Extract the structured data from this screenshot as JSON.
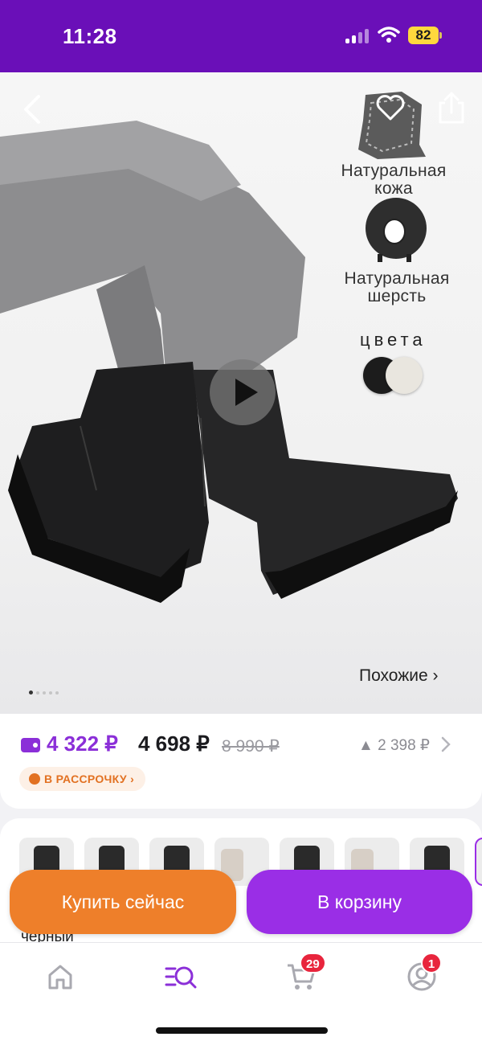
{
  "status_bar": {
    "time": "11:28",
    "battery": "82"
  },
  "product_image": {
    "features": {
      "leather_line1": "Натуральная",
      "leather_line2": "кожа",
      "wool_line1": "Натуральная",
      "wool_line2": "шерсть"
    },
    "colors_label": "цвета",
    "swatch_colors": [
      "#1c1c1c",
      "#e9e6df"
    ],
    "similar_label": "Похожие",
    "gallery_dots": 5,
    "active_dot": 1
  },
  "price": {
    "wallet_price": "4 322 ₽",
    "main_price": "4 698 ₽",
    "old_price": "8 990 ₽",
    "price_trend": "2 398 ₽",
    "installment_label": "В РАССРОЧКУ"
  },
  "variants": {
    "selected_name": "черный",
    "thumbnail_count": 7
  },
  "actions": {
    "buy_now_label": "Купить сейчас",
    "add_to_cart_label": "В корзину"
  },
  "tab_bar": {
    "cart_badge": "29",
    "profile_badge": "1"
  },
  "colors": {
    "brand_purple": "#6a0fb8",
    "accent_purple": "#9a2ee6",
    "accent_orange": "#ee7f2a",
    "badge_red": "#e8253d"
  }
}
